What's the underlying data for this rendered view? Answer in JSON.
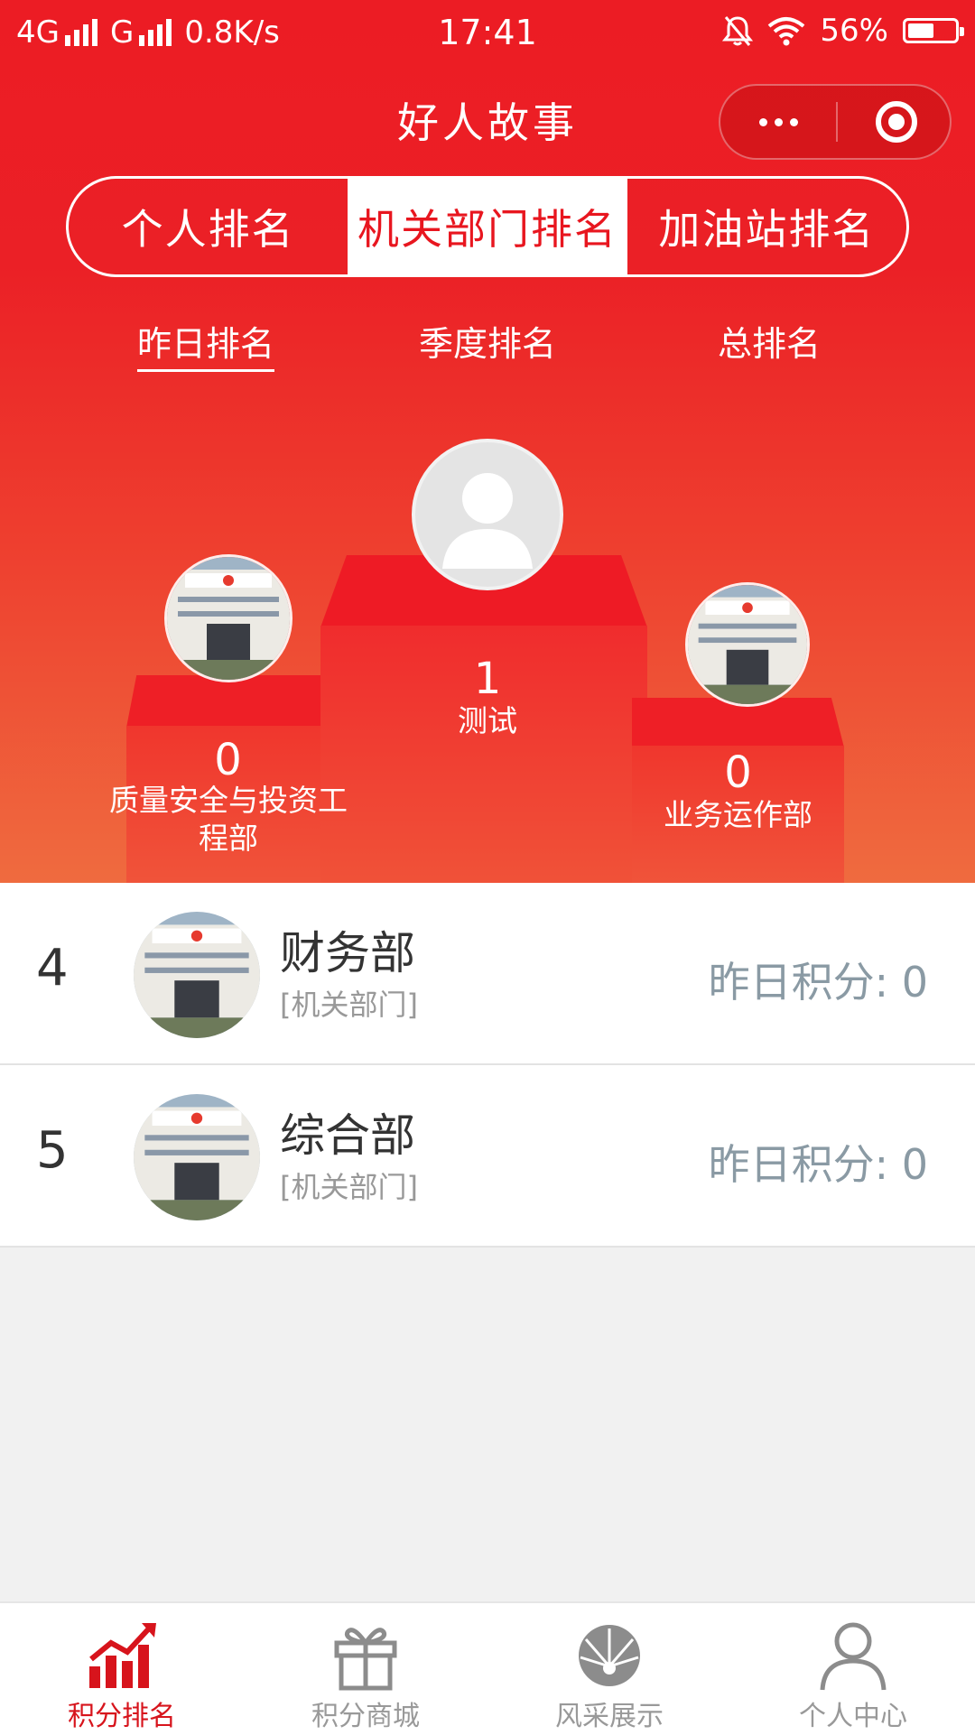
{
  "status_bar": {
    "network_1": "4G",
    "network_2": "G",
    "speed": "0.8K/s",
    "time": "17:41",
    "battery": "56%",
    "battery_level": 0.56
  },
  "header": {
    "title": "好人故事"
  },
  "segment_tabs": [
    {
      "label": "个人排名",
      "active": false
    },
    {
      "label": "机关部门排名",
      "active": true
    },
    {
      "label": "加油站排名",
      "active": false
    }
  ],
  "sub_tabs": [
    {
      "label": "昨日排名",
      "active": true
    },
    {
      "label": "季度排名",
      "active": false
    },
    {
      "label": "总排名",
      "active": false
    }
  ],
  "podium": {
    "first": {
      "score": "1",
      "name": "测试"
    },
    "second": {
      "score": "0",
      "name": "质量安全与投资工程部"
    },
    "third": {
      "score": "0",
      "name": "业务运作部"
    }
  },
  "list": [
    {
      "rank": "4",
      "name": "财务部",
      "type": "[机关部门]",
      "score_label": "昨日积分: 0"
    },
    {
      "rank": "5",
      "name": "综合部",
      "type": "[机关部门]",
      "score_label": "昨日积分: 0"
    }
  ],
  "tabbar": [
    {
      "label": "积分排名",
      "icon": "ranking-chart-icon",
      "active": true
    },
    {
      "label": "积分商城",
      "icon": "gift-icon",
      "active": false
    },
    {
      "label": "风采展示",
      "icon": "petrochina-logo-icon",
      "active": false
    },
    {
      "label": "个人中心",
      "icon": "person-icon",
      "active": false
    }
  ],
  "colors": {
    "brand_red": "#ec1c24",
    "active_tab_text": "#d7141c",
    "score_gray": "#8a9aa4"
  }
}
